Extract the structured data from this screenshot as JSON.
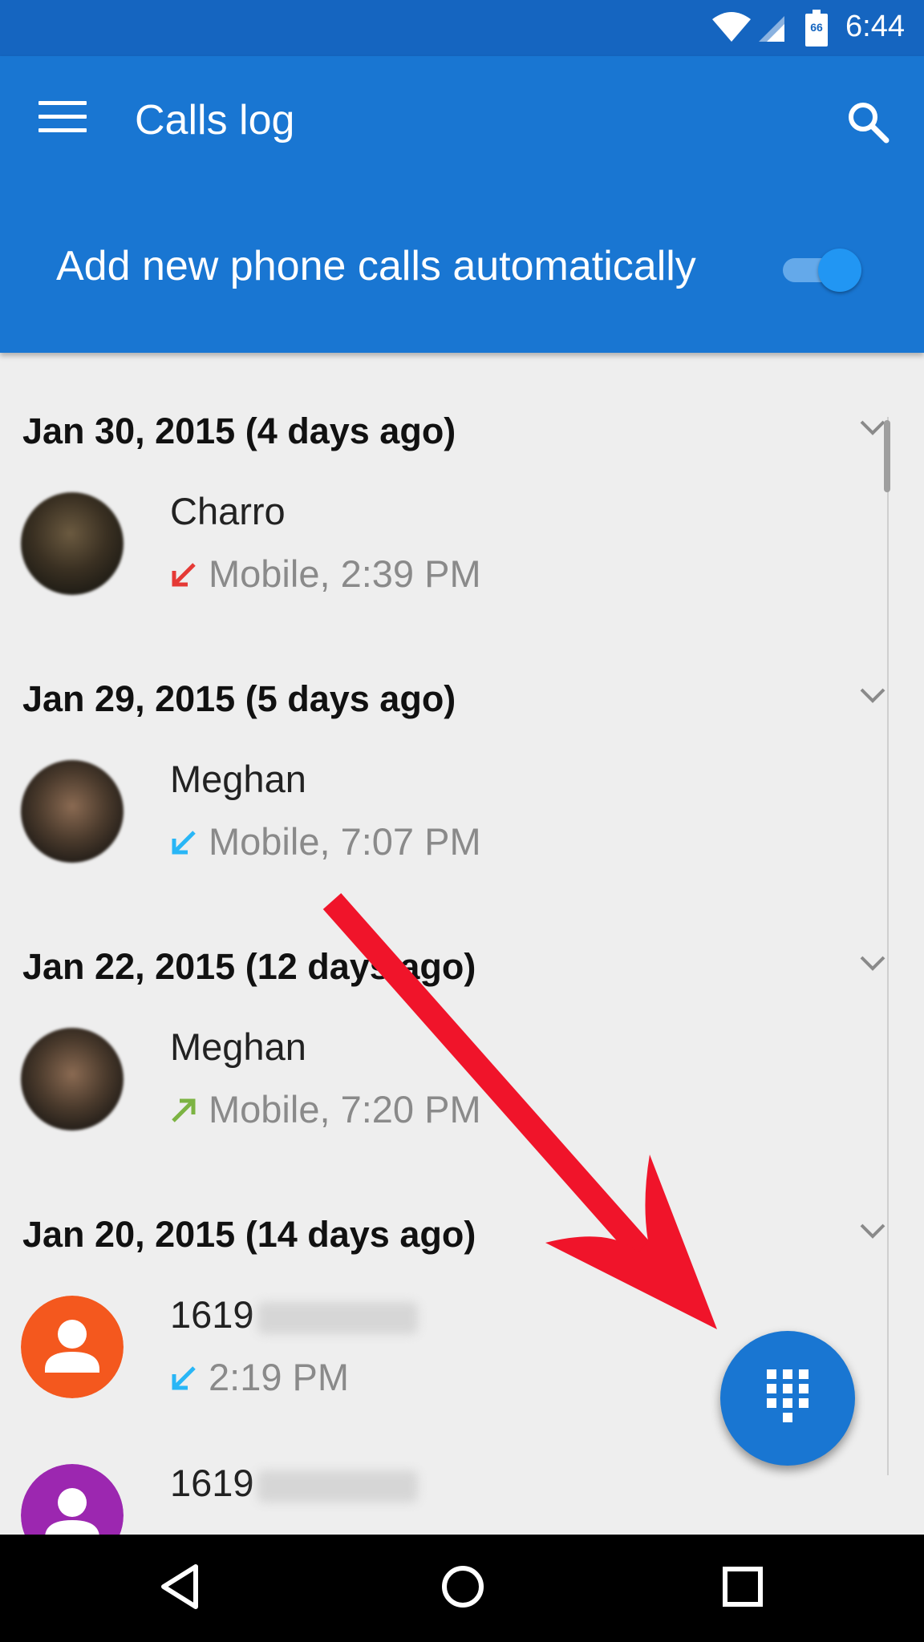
{
  "status_bar": {
    "time": "6:44",
    "battery_level": "66",
    "icons": [
      "wifi-icon",
      "cell-signal-icon",
      "battery-icon"
    ]
  },
  "app_bar": {
    "title": "Calls log",
    "menu_icon": "hamburger-menu-icon",
    "search_icon": "search-icon",
    "auto_add_label": "Add new phone calls automatically",
    "auto_add_enabled": true
  },
  "groups": [
    {
      "header": "Jan 30, 2015 (4 days ago)",
      "calls": [
        {
          "name": "Charro",
          "detail": "Mobile, 2:39 PM",
          "direction": "missed",
          "avatar": "photo"
        }
      ]
    },
    {
      "header": "Jan 29, 2015 (5 days ago)",
      "calls": [
        {
          "name": "Meghan",
          "detail": "Mobile, 7:07 PM",
          "direction": "incoming",
          "avatar": "photo"
        }
      ]
    },
    {
      "header": "Jan 22, 2015 (12 days ago)",
      "calls": [
        {
          "name": "Meghan",
          "detail": "Mobile, 7:20 PM",
          "direction": "outgoing",
          "avatar": "photo"
        }
      ]
    },
    {
      "header": "Jan 20, 2015 (14 days ago)",
      "calls": [
        {
          "name": "1619",
          "detail": "2:19 PM",
          "direction": "incoming",
          "avatar": "generic-orange"
        },
        {
          "name": "1619",
          "detail": "",
          "direction": "",
          "avatar": "generic-purple"
        }
      ]
    }
  ],
  "fab": {
    "icon": "dialpad-icon"
  },
  "nav_bar": {
    "icons": [
      "back-icon",
      "home-icon",
      "recents-icon"
    ]
  },
  "colors": {
    "status_bar": "#1565c0",
    "app_bar": "#1976d2",
    "accent": "#2196f3",
    "missed": "#e53935",
    "incoming": "#29b6f6",
    "outgoing": "#7cb342",
    "annotation": "#f0142a"
  }
}
